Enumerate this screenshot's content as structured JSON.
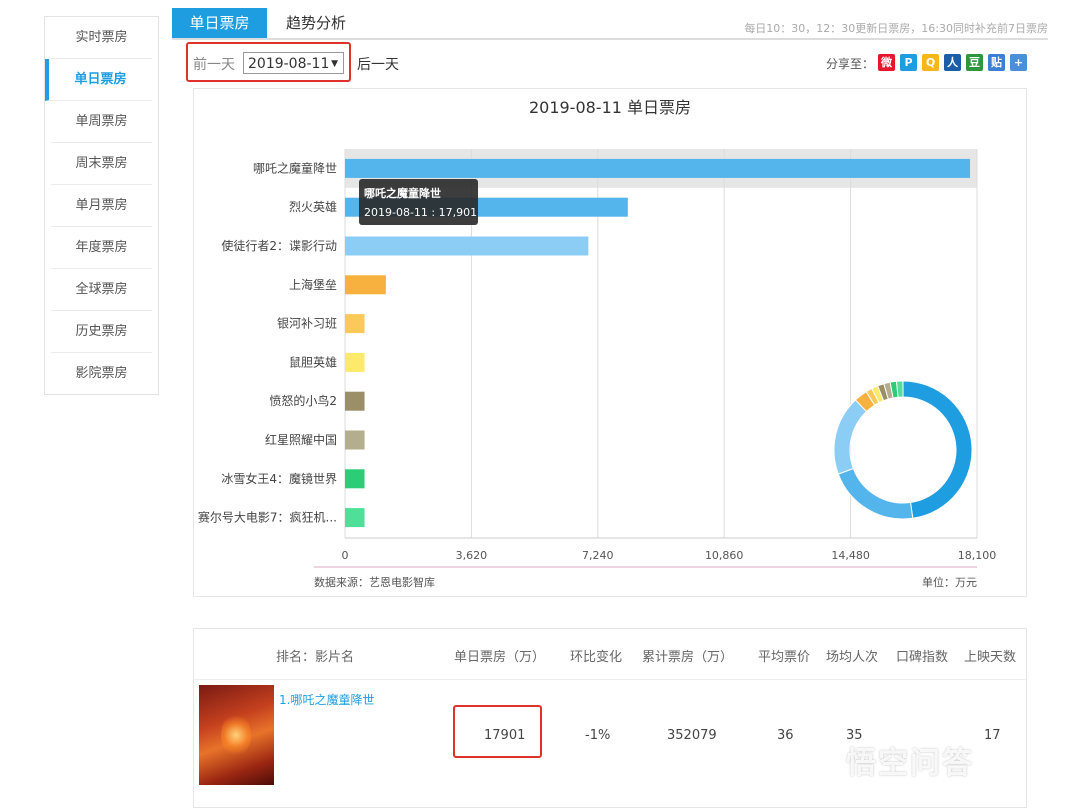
{
  "sidebar": {
    "items": [
      {
        "label": "实时票房"
      },
      {
        "label": "单日票房"
      },
      {
        "label": "单周票房"
      },
      {
        "label": "周末票房"
      },
      {
        "label": "单月票房"
      },
      {
        "label": "年度票房"
      },
      {
        "label": "全球票房"
      },
      {
        "label": "历史票房"
      },
      {
        "label": "影院票房"
      }
    ],
    "active_index": 1
  },
  "tabs": {
    "daily": "单日票房",
    "trend": "趋势分析",
    "update_note": "每日10：30，12：30更新日票房，16:30同时补充前7日票房"
  },
  "date_nav": {
    "prev_label": "前一天",
    "date_value": "2019-08-11",
    "next_label": "后一天"
  },
  "share": {
    "label": "分享至：",
    "icons": [
      {
        "name": "weibo-icon",
        "glyph": "微",
        "color": "#e6162d"
      },
      {
        "name": "qzone-icon",
        "glyph": "P",
        "color": "#1e9ee0"
      },
      {
        "name": "qq-icon",
        "glyph": "Q",
        "color": "#f5b81b"
      },
      {
        "name": "renren-icon",
        "glyph": "人",
        "color": "#1c5ea8"
      },
      {
        "name": "douban-icon",
        "glyph": "豆",
        "color": "#2e963d"
      },
      {
        "name": "tieba-icon",
        "glyph": "贴",
        "color": "#3b7fd6"
      },
      {
        "name": "more-icon",
        "glyph": "+",
        "color": "#4a8fd8"
      }
    ]
  },
  "chart_data": {
    "type": "bar",
    "title": "2019-08-11 单日票房",
    "categories": [
      "哪吒之魔童降世",
      "烈火英雄",
      "使徒行者2：谍影行动",
      "上海堡垒",
      "银河补习班",
      "鼠胆英雄",
      "愤怒的小鸟2",
      "红星照耀中国",
      "冰雪女王4：魔镜世界",
      "赛尔号大电影7：疯狂机..."
    ],
    "values": [
      17901,
      8100,
      6970,
      1170,
      560,
      560,
      560,
      560,
      560,
      560
    ],
    "colors": [
      "#54b4ec",
      "#54b4ec",
      "#8ccdf5",
      "#f7b13e",
      "#fbc95a",
      "#fde96a",
      "#9a8f66",
      "#b5ae8e",
      "#2bcd77",
      "#4ee098"
    ],
    "xlim": [
      0,
      18100
    ],
    "ticks": [
      "0",
      "3,620",
      "7,240",
      "10,860",
      "14,480",
      "18,100"
    ],
    "grid": true,
    "tooltip": {
      "title": "哪吒之魔童降世",
      "text": "2019-08-11 : 17,901"
    },
    "source": "数据来源：艺恩电影智库",
    "unit": "单位：万元",
    "donut_colors": [
      "#1e9ee0",
      "#54b4ec",
      "#8ccdf5",
      "#f7b13e",
      "#fbc95a",
      "#fde96a",
      "#9a8f66",
      "#b5ae8e",
      "#2bcd77",
      "#4ee098"
    ]
  },
  "table": {
    "headers": [
      "排名：影片名",
      "单日票房（万）",
      "环比变化",
      "累计票房（万）",
      "平均票价",
      "场均人次",
      "口碑指数",
      "上映天数"
    ],
    "rows": [
      {
        "rank_title": "1.哪吒之魔童降世",
        "daily": "17901",
        "change": "-1%",
        "total": "352079",
        "avg_price": "36",
        "avg_people": "35",
        "score": "",
        "days": "17"
      }
    ]
  },
  "watermark": "悟空问答"
}
